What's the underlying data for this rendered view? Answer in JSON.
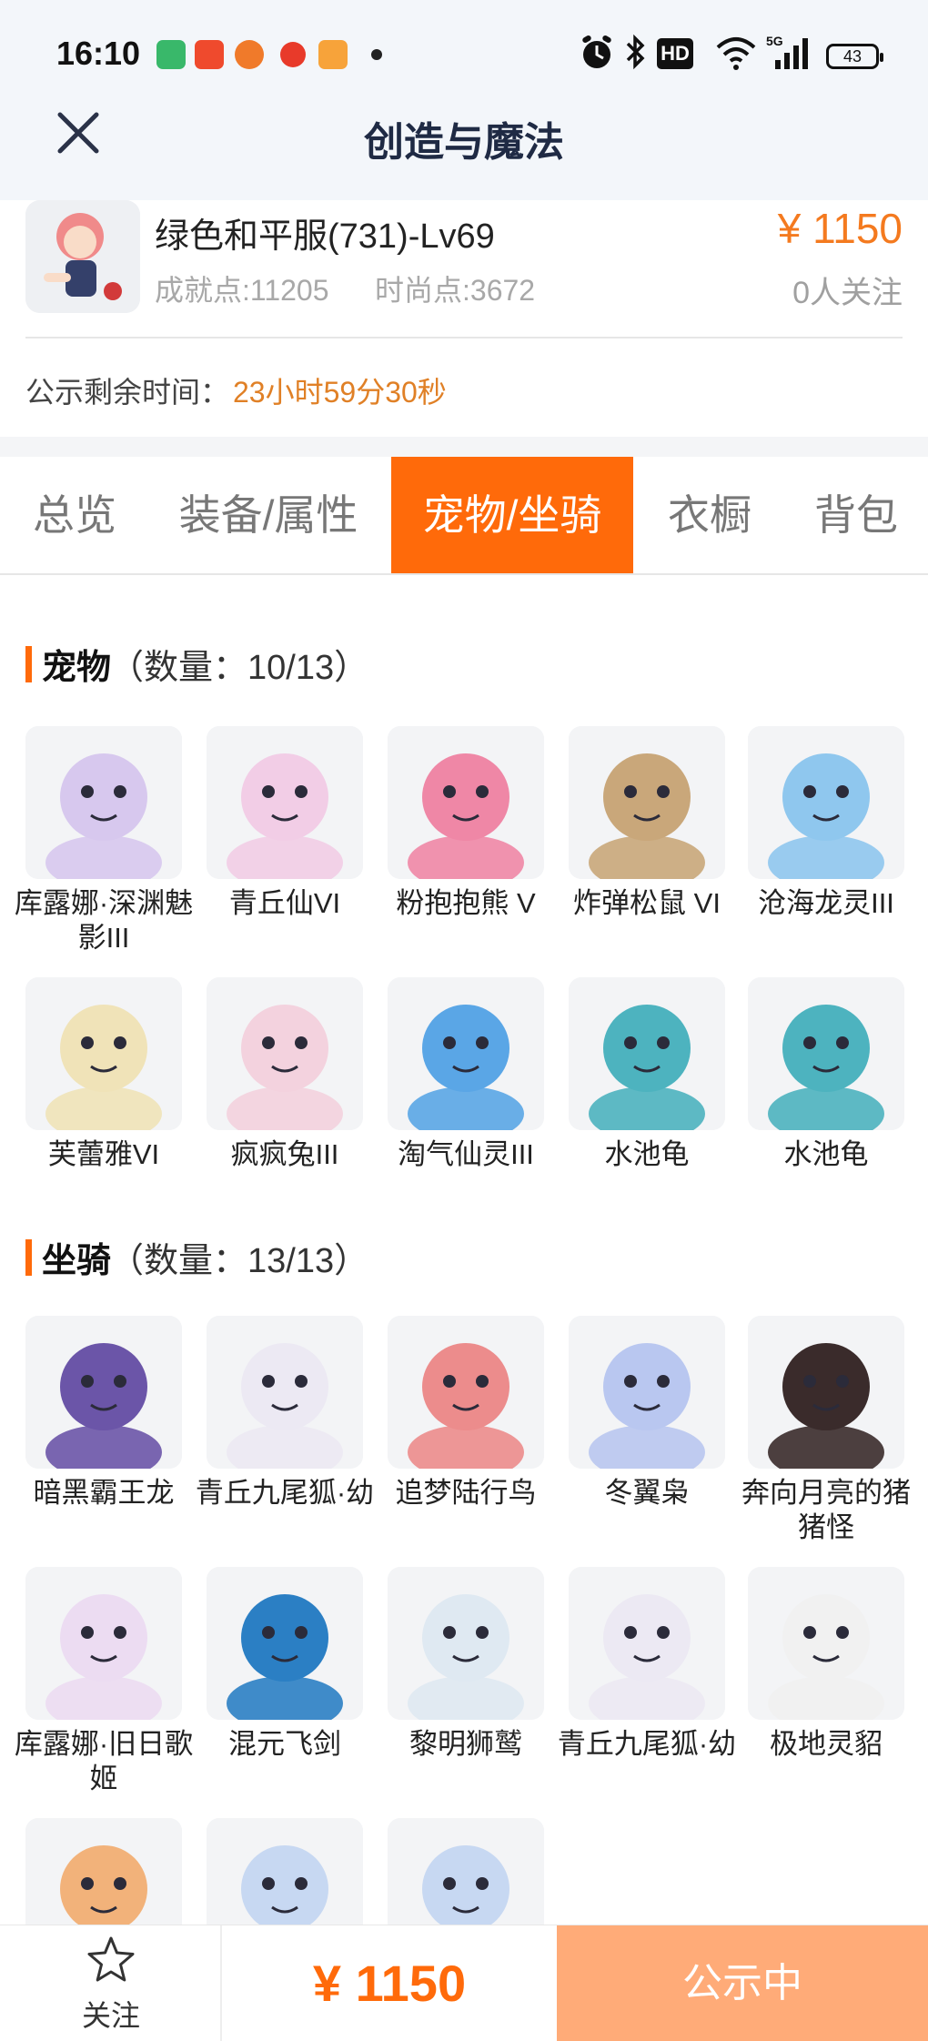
{
  "status_bar": {
    "time": "16:10",
    "icons": [
      "messages-app-icon",
      "video-app-icon",
      "game-app-icon",
      "red-app-icon",
      "tv-app-icon",
      "dot-icon",
      "alarm-icon",
      "bluetooth-icon",
      "hd-icon",
      "wifi-icon",
      "signal-5g-icon"
    ],
    "battery": "43"
  },
  "header": {
    "title": "创造与魔法",
    "close_icon": "close-icon"
  },
  "listing": {
    "character_name": "绿色和平服(731)-Lv69",
    "price": "¥ 1150",
    "achievement": "成就点:11205",
    "fashion": "时尚点:3672",
    "followers": "0人关注",
    "timer_label": "公示剩余时间：",
    "timer_value": "23小时59分30秒"
  },
  "tabs": [
    {
      "label": "总览",
      "active": false
    },
    {
      "label": "装备/属性",
      "active": false
    },
    {
      "label": "宠物/坐骑",
      "active": true
    },
    {
      "label": "衣橱",
      "active": false
    },
    {
      "label": "背包",
      "active": false
    }
  ],
  "pets": {
    "title": "宠物",
    "count": "（数量：10/13）",
    "items": [
      {
        "label": "库露娜·深渊魅影III",
        "color": "#d7c8ee"
      },
      {
        "label": "青丘仙VI",
        "color": "#f2cde6"
      },
      {
        "label": "粉抱抱熊 V",
        "color": "#ef87a6"
      },
      {
        "label": "炸弹松鼠 VI",
        "color": "#c9a77a"
      },
      {
        "label": "沧海龙灵III",
        "color": "#8fc7ee"
      },
      {
        "label": "芙蕾雅VI",
        "color": "#f0e3b8"
      },
      {
        "label": "疯疯兔III",
        "color": "#f3d2de"
      },
      {
        "label": "淘气仙灵III",
        "color": "#5aa6e6"
      },
      {
        "label": "水池龟",
        "color": "#4db3bf"
      },
      {
        "label": "水池龟",
        "color": "#4db3bf"
      }
    ]
  },
  "mounts": {
    "title": "坐骑",
    "count": "（数量：13/13）",
    "items": [
      {
        "label": "暗黑霸王龙",
        "color": "#6b55a8"
      },
      {
        "label": "青丘九尾狐·幼",
        "color": "#ece9f3"
      },
      {
        "label": "追梦陆行鸟",
        "color": "#ec8c8c"
      },
      {
        "label": "冬翼枭",
        "color": "#b9c7f0"
      },
      {
        "label": "奔向月亮的猪猪怪",
        "color": "#3a2b2b"
      },
      {
        "label": "库露娜·旧日歌姬",
        "color": "#ecdcf2"
      },
      {
        "label": "混元飞剑",
        "color": "#2b7fc4"
      },
      {
        "label": "黎明狮鹫",
        "color": "#dfe9f2"
      },
      {
        "label": "青丘九尾狐·幼",
        "color": "#ece9f3"
      },
      {
        "label": "极地灵貂",
        "color": "#f1f1f1"
      },
      {
        "label": "",
        "color": "#f2b27a"
      },
      {
        "label": "",
        "color": "#c7d8f2"
      },
      {
        "label": "",
        "color": "#c7d8f2"
      }
    ]
  },
  "bottom_bar": {
    "follow_icon": "star-icon",
    "follow_label": "关注",
    "price": "¥ 1150",
    "status_button": "公示中",
    "accent": "#ff6a0a"
  }
}
